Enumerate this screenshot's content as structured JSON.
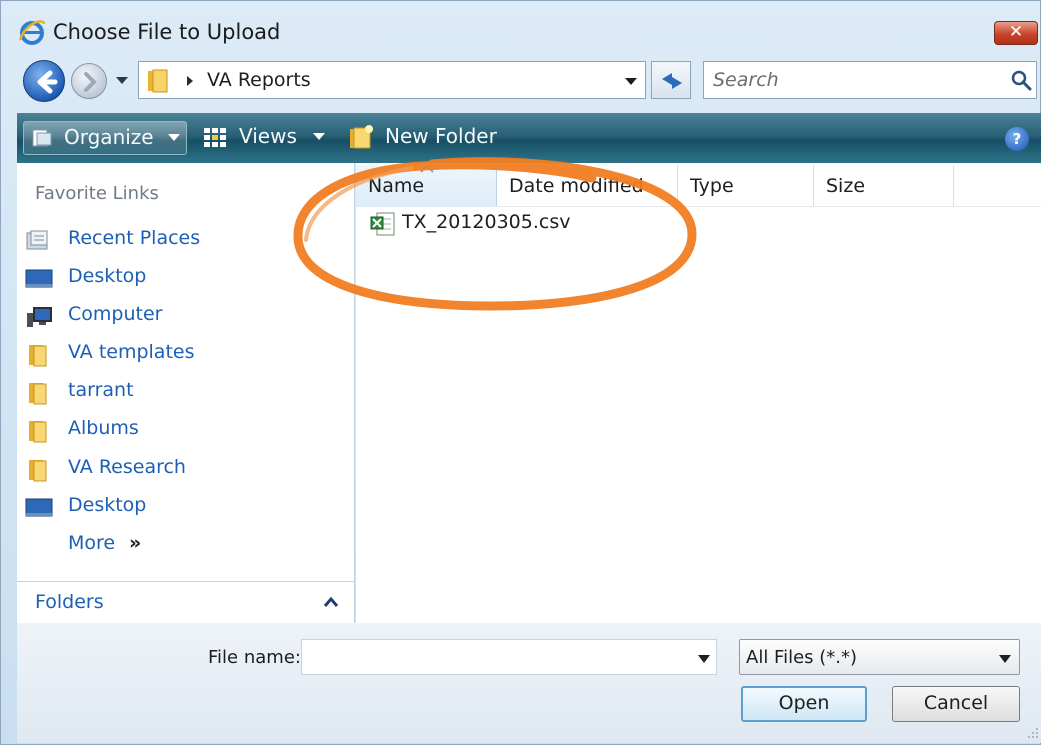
{
  "window": {
    "title": "Choose File to Upload",
    "close_label": "✕"
  },
  "nav": {
    "address_path": "VA Reports",
    "search_placeholder": "Search"
  },
  "toolbar": {
    "organize_label": "Organize",
    "views_label": "Views",
    "new_folder_label": "New Folder",
    "help_label": "?"
  },
  "sidebar": {
    "section_title": "Favorite Links",
    "items": [
      {
        "label": "Recent Places",
        "icon": "recent-places-icon"
      },
      {
        "label": "Desktop",
        "icon": "desktop-icon"
      },
      {
        "label": "Computer",
        "icon": "computer-icon"
      },
      {
        "label": "VA templates",
        "icon": "folder-icon"
      },
      {
        "label": "tarrant",
        "icon": "folder-icon"
      },
      {
        "label": "Albums",
        "icon": "folder-icon"
      },
      {
        "label": "VA Research",
        "icon": "folder-icon"
      },
      {
        "label": "Desktop",
        "icon": "desktop-icon"
      }
    ],
    "more_label": "More",
    "more_chevron": "»",
    "folders_label": "Folders"
  },
  "file_list": {
    "columns": [
      "Name",
      "Date modified",
      "Type",
      "Size"
    ],
    "files": [
      {
        "name": "TX_20120305.csv",
        "icon": "excel-csv-file-icon"
      }
    ]
  },
  "footer": {
    "filename_label": "File name:",
    "filename_value": "",
    "filter_value": "All Files (*.*)",
    "open_label": "Open",
    "cancel_label": "Cancel"
  },
  "colors": {
    "link_blue": "#1d5fb4",
    "toolbar_teal": "#2a6076",
    "highlight_orange": "#f07d22"
  }
}
